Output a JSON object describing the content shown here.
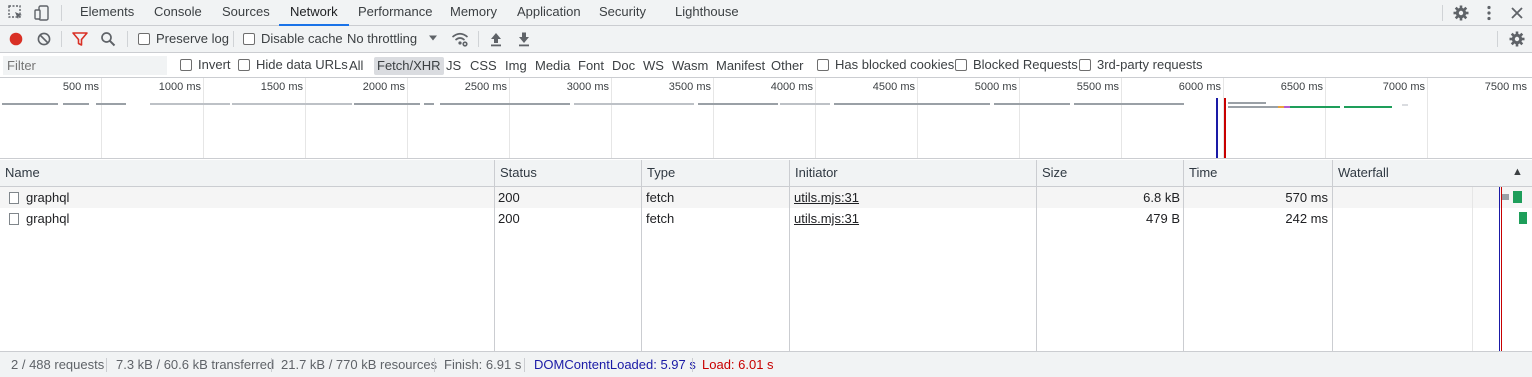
{
  "tabs": [
    "Elements",
    "Console",
    "Sources",
    "Network",
    "Performance",
    "Memory",
    "Application",
    "Security",
    "Lighthouse"
  ],
  "active_tab": "Network",
  "toolbar": {
    "preserve_log": "Preserve log",
    "disable_cache": "Disable cache",
    "throttling": "No throttling"
  },
  "filterbar": {
    "filter_placeholder": "Filter",
    "invert": "Invert",
    "hide_data_urls": "Hide data URLs",
    "types": [
      "All",
      "Fetch/XHR",
      "JS",
      "CSS",
      "Img",
      "Media",
      "Font",
      "Doc",
      "WS",
      "Wasm",
      "Manifest",
      "Other"
    ],
    "selected_type": "Fetch/XHR",
    "has_blocked_cookies": "Has blocked cookies",
    "blocked_requests": "Blocked Requests",
    "third_party": "3rd-party requests"
  },
  "overview": {
    "ticks": [
      "500 ms",
      "1000 ms",
      "1500 ms",
      "2000 ms",
      "2500 ms",
      "3000 ms",
      "3500 ms",
      "4000 ms",
      "4500 ms",
      "5000 ms",
      "5500 ms",
      "6000 ms",
      "6500 ms",
      "7000 ms",
      "7500 ms"
    ],
    "dom_content_loaded_color": "#1a1aa6",
    "load_color": "#c80000"
  },
  "table": {
    "headers": {
      "name": "Name",
      "status": "Status",
      "type": "Type",
      "initiator": "Initiator",
      "size": "Size",
      "time": "Time",
      "waterfall": "Waterfall"
    },
    "sort_indicator": "▲",
    "rows": [
      {
        "name": "graphql",
        "status": "200",
        "type": "fetch",
        "initiator": "utils.mjs:31",
        "size": "6.8 kB",
        "time": "570 ms"
      },
      {
        "name": "graphql",
        "status": "200",
        "type": "fetch",
        "initiator": "utils.mjs:31",
        "size": "479 B",
        "time": "242 ms"
      }
    ]
  },
  "status": {
    "requests": "2 / 488 requests",
    "transferred": "7.3 kB / 60.6 kB transferred",
    "resources": "21.7 kB / 770 kB resources",
    "finish": "Finish: 6.91 s",
    "dom_content_loaded": "DOMContentLoaded: 5.97 s",
    "load": "Load: 6.01 s"
  },
  "colors": {
    "accent": "#1a73e8",
    "record": "#d93025",
    "filter_icon": "#d93025",
    "waterfall_green": "#1e9e5a"
  }
}
